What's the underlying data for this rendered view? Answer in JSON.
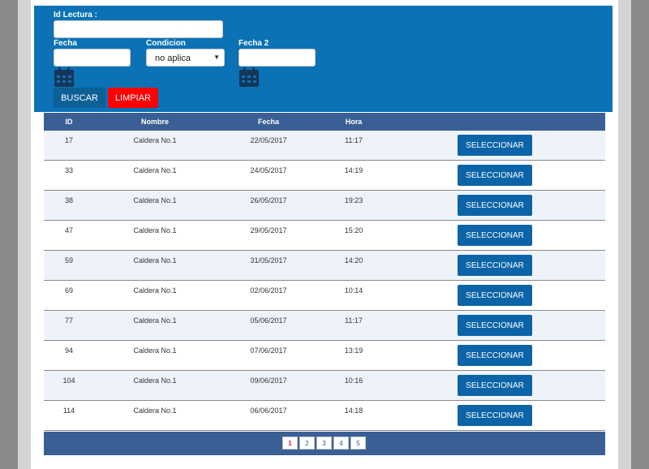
{
  "search": {
    "id_lectura_label": "Id Lectura :",
    "id_lectura_value": "",
    "fecha_label": "Fecha",
    "fecha_value": "",
    "condicion_label": "Condicion",
    "condicion_selected": "no aplica",
    "fecha2_label": "Fecha 2",
    "fecha2_value": "",
    "buscar_label": "BUSCAR",
    "limpiar_label": "LIMPIAR"
  },
  "table": {
    "headers": {
      "id": "ID",
      "nombre": "Nombre",
      "fecha": "Fecha",
      "hora": "Hora"
    },
    "select_label": "SELECCIONAR",
    "rows": [
      {
        "id": "17",
        "nombre": "Caldera No.1",
        "fecha": "22/05/2017",
        "hora": "11:17"
      },
      {
        "id": "33",
        "nombre": "Caldera No.1",
        "fecha": "24/05/2017",
        "hora": "14:19"
      },
      {
        "id": "38",
        "nombre": "Caldera No.1",
        "fecha": "26/05/2017",
        "hora": "19:23"
      },
      {
        "id": "47",
        "nombre": "Caldera No.1",
        "fecha": "29/05/2017",
        "hora": "15:20"
      },
      {
        "id": "59",
        "nombre": "Caldera No.1",
        "fecha": "31/05/2017",
        "hora": "14:20"
      },
      {
        "id": "69",
        "nombre": "Caldera No.1",
        "fecha": "02/06/2017",
        "hora": "10:14"
      },
      {
        "id": "77",
        "nombre": "Caldera No.1",
        "fecha": "05/06/2017",
        "hora": "11:17"
      },
      {
        "id": "94",
        "nombre": "Caldera No.1",
        "fecha": "07/06/2017",
        "hora": "13:19"
      },
      {
        "id": "104",
        "nombre": "Caldera No.1",
        "fecha": "09/06/2017",
        "hora": "10:16"
      },
      {
        "id": "114",
        "nombre": "Caldera No.1",
        "fecha": "06/06/2017",
        "hora": "14:18"
      }
    ]
  },
  "pagination": {
    "pages": [
      "1",
      "2",
      "3",
      "4",
      "5"
    ],
    "current": "1"
  },
  "colors": {
    "panel": "#0a72b5",
    "header": "#3a5f94",
    "button": "#0b64a8",
    "clear_button": "#ff0000",
    "row_alt": "#eef3fa"
  },
  "icons": {
    "date_picker": "calendar-icon"
  }
}
